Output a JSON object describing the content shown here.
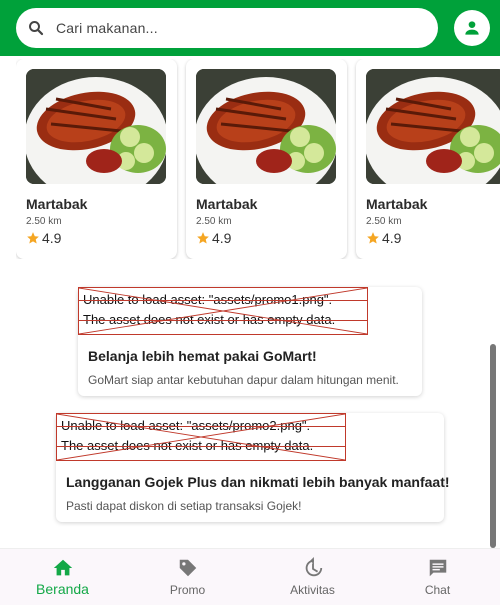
{
  "search": {
    "placeholder": "Cari makanan...",
    "icon": "search-icon"
  },
  "profile": {
    "icon": "person-icon"
  },
  "food_cards": [
    {
      "name": "Martabak",
      "distance": "2.50 km",
      "rating": "4.9"
    },
    {
      "name": "Martabak",
      "distance": "2.50 km",
      "rating": "4.9"
    },
    {
      "name": "Martabak",
      "distance": "2.50 km",
      "rating": "4.9"
    }
  ],
  "promos": [
    {
      "error_line1": "Unable to load asset: \"assets/promo1.png\".",
      "error_line2": "The asset does not exist or has empty data.",
      "title": "Belanja lebih hemat pakai GoMart!",
      "description": "GoMart siap antar kebutuhan dapur dalam hitungan menit."
    },
    {
      "error_line1": "Unable to load asset: \"assets/promo2.png\".",
      "error_line2": "The asset does not exist or has empty data.",
      "title": "Langganan Gojek Plus dan nikmati lebih banyak manfaat!",
      "description": "Pasti dapat diskon di setiap transaksi Gojek!"
    }
  ],
  "nav": [
    {
      "label": "Beranda",
      "icon": "home-icon",
      "active": true
    },
    {
      "label": "Promo",
      "icon": "tag-icon",
      "active": false
    },
    {
      "label": "Aktivitas",
      "icon": "history-icon",
      "active": false
    },
    {
      "label": "Chat",
      "icon": "chat-icon",
      "active": false
    }
  ],
  "colors": {
    "primary": "#00a13a",
    "accent": "#13a847",
    "star": "#f5a623",
    "error": "#c0392b"
  }
}
